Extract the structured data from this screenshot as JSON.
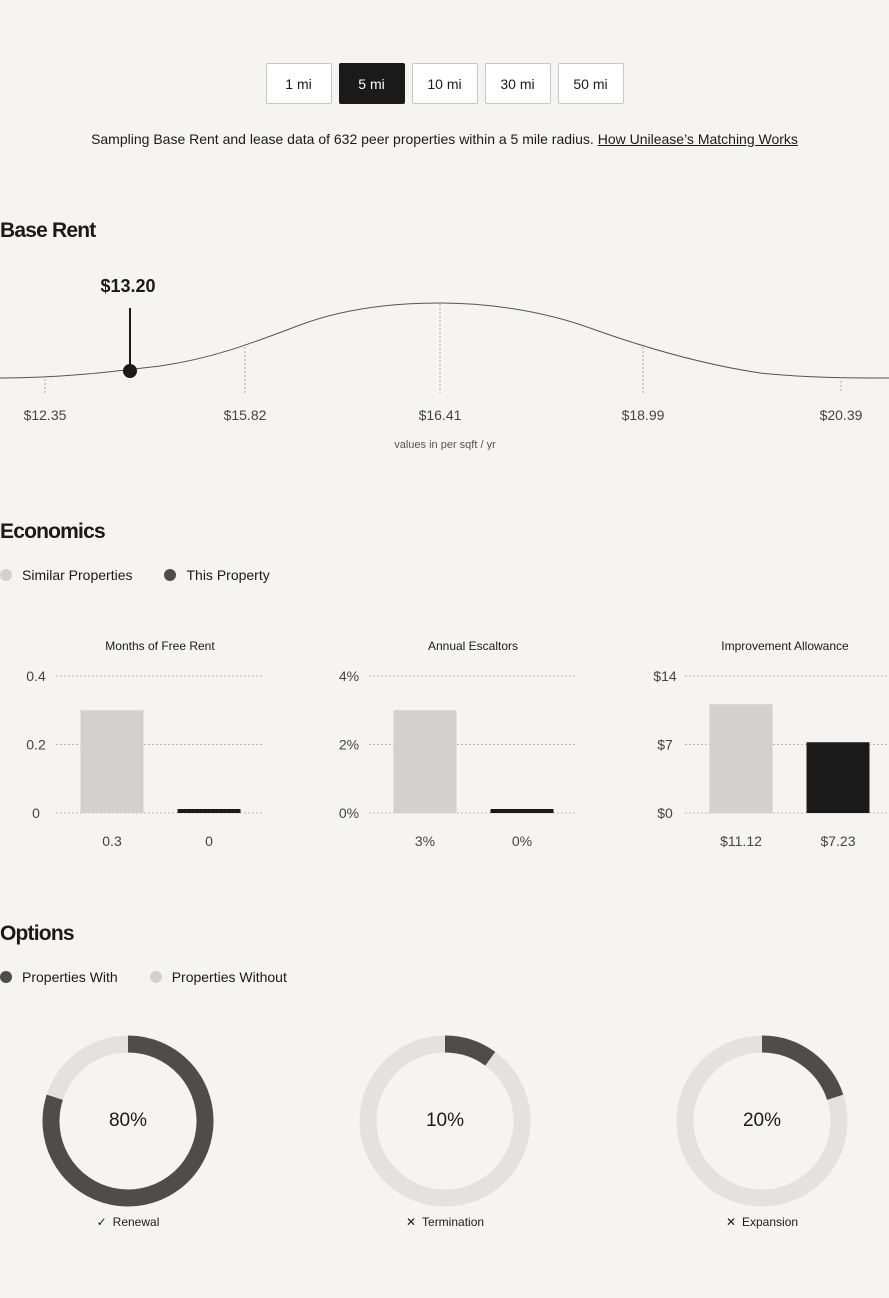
{
  "radius": {
    "options": [
      "1 mi",
      "5 mi",
      "10 mi",
      "30 mi",
      "50 mi"
    ],
    "selected_index": 1
  },
  "sampling": {
    "text": "Sampling Base Rent and lease data of 632 peer properties within a 5 mile radius.",
    "link": "How Unilease’s Matching Works"
  },
  "base_rent": {
    "title": "Base Rent",
    "marker_label": "$13.20",
    "ticks": [
      "$12.35",
      "$15.82",
      "$16.41",
      "$18.99",
      "$20.39"
    ],
    "units_note": "values in per sqft / yr"
  },
  "economics": {
    "title": "Economics",
    "legend": [
      {
        "label": "Similar Properties",
        "color": "#d3d1cd"
      },
      {
        "label": "This Property",
        "color": "#4f4d4a"
      }
    ]
  },
  "options": {
    "title": "Options",
    "legend": [
      {
        "label": "Properties With",
        "color": "#4f4d4a"
      },
      {
        "label": "Properties Without",
        "color": "#d3d1cd"
      }
    ]
  },
  "chart_data": [
    {
      "type": "bar",
      "title": "Months of Free Rent",
      "categories": [
        "Similar Properties",
        "This Property"
      ],
      "values": [
        0.3,
        0
      ],
      "value_labels": [
        "0.3",
        "0"
      ],
      "ylim": [
        0,
        0.4
      ],
      "yticks": [
        "0.4",
        "0.2",
        "0"
      ],
      "grid": true,
      "colors": [
        "#d3d1cd",
        "#1a1a1a"
      ]
    },
    {
      "type": "bar",
      "title": "Annual Escaltors",
      "categories": [
        "Similar Properties",
        "This Property"
      ],
      "values": [
        3,
        0
      ],
      "value_labels": [
        "3%",
        "0%"
      ],
      "ylim": [
        0,
        4
      ],
      "yticks": [
        "4%",
        "2%",
        "0%"
      ],
      "grid": true,
      "colors": [
        "#d3d1cd",
        "#1a1a1a"
      ]
    },
    {
      "type": "bar",
      "title": "Improvement Allowance",
      "categories": [
        "Similar Properties",
        "This Property"
      ],
      "values": [
        11.12,
        7.23
      ],
      "value_labels": [
        "$11.12",
        "$7.23"
      ],
      "ylim": [
        0,
        14
      ],
      "yticks": [
        "$14",
        "$7",
        "$0"
      ],
      "grid": true,
      "colors": [
        "#d3d1cd",
        "#1a1a1a"
      ]
    },
    {
      "type": "pie",
      "label": "Renewal",
      "status": "check",
      "values": [
        80,
        20
      ],
      "pct_label": "80%"
    },
    {
      "type": "pie",
      "label": "Termination",
      "status": "cross",
      "values": [
        10,
        90
      ],
      "pct_label": "10%"
    },
    {
      "type": "pie",
      "label": "Expansion",
      "status": "cross",
      "values": [
        20,
        80
      ],
      "pct_label": "20%"
    }
  ],
  "icons": {
    "check": "✓",
    "cross": "✕"
  }
}
